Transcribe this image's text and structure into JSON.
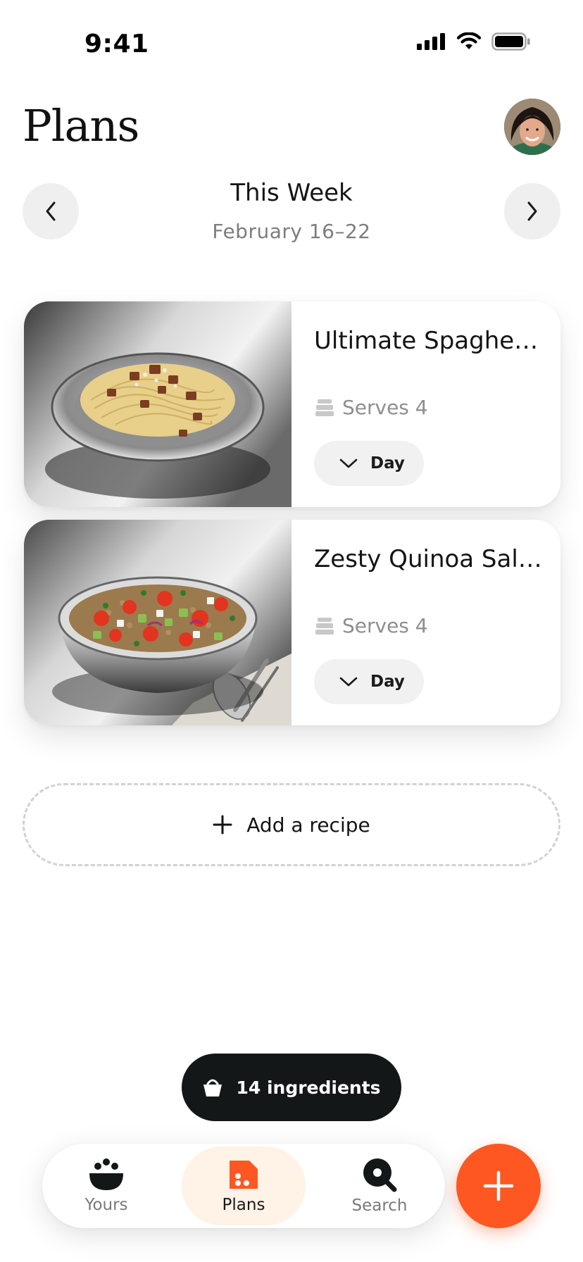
{
  "status_bar": {
    "time": "9:41",
    "icons": [
      "cellular-signal-icon",
      "wifi-icon",
      "battery-icon"
    ]
  },
  "header": {
    "title": "Plans",
    "avatar": "avatar"
  },
  "week": {
    "title": "This Week",
    "range": "February 16–22",
    "prev_icon": "chevron-left-icon",
    "next_icon": "chevron-right-icon"
  },
  "recipes": [
    {
      "title": "Ultimate Spaghetti Carbonara",
      "serves_label": "Serves 4",
      "day_label": "Day",
      "image": "spaghetti-carbonara-image"
    },
    {
      "title": "Zesty Quinoa Salad",
      "serves_label": "Serves 4",
      "day_label": "Day",
      "image": "quinoa-salad-image"
    }
  ],
  "add_recipe": {
    "label": "Add a recipe",
    "icon": "plus-icon"
  },
  "ingredients": {
    "label": "14 ingredients",
    "icon": "basket-icon"
  },
  "tabs": [
    {
      "label": "Yours",
      "icon": "bowl-icon",
      "active": false
    },
    {
      "label": "Plans",
      "icon": "plan-document-icon",
      "active": true
    },
    {
      "label": "Search",
      "icon": "search-icon",
      "active": false
    }
  ],
  "fab": {
    "icon": "plus-icon"
  },
  "colors": {
    "accent": "#fe5722",
    "active_tab_bg": "#fff2e6",
    "pill_bg": "#131717",
    "muted_text": "#7d7d7d"
  }
}
